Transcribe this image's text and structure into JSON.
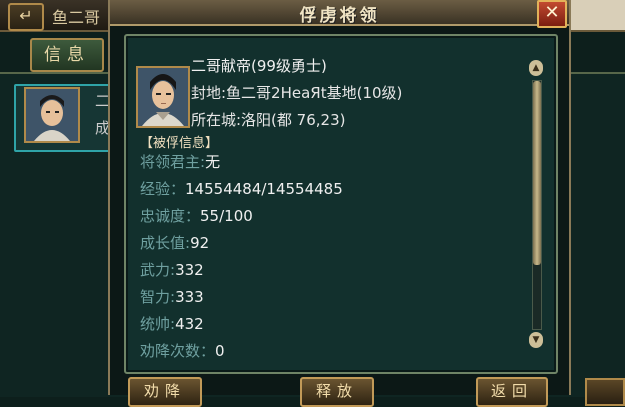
{
  "background": {
    "title": "鱼二哥",
    "tab_label": "信息",
    "card_line1": "二",
    "card_line2": "成"
  },
  "popup": {
    "title": "俘虏将领",
    "close_label": "✕",
    "general": {
      "name_line": "二哥献帝(99级勇士)",
      "fief_line": "封地:鱼二哥2HeaЯt基地(10级)",
      "city_line": "所在城:洛阳(都 76,23)"
    },
    "section_title": "【被俘信息】",
    "fields": [
      {
        "label": "将领君主:",
        "value": "无"
      },
      {
        "label": "经验：",
        "value": "14554484/14554485"
      },
      {
        "label": "忠诚度：",
        "value": "55/100"
      },
      {
        "label": "成长值:",
        "value": "92"
      },
      {
        "label": "武力:",
        "value": "332"
      },
      {
        "label": "智力:",
        "value": "333"
      },
      {
        "label": "统帅:",
        "value": "432"
      },
      {
        "label": "劝降次数：",
        "value": "0"
      }
    ],
    "buttons": {
      "persuade": "劝降",
      "release": "释放",
      "back": "返回"
    }
  }
}
